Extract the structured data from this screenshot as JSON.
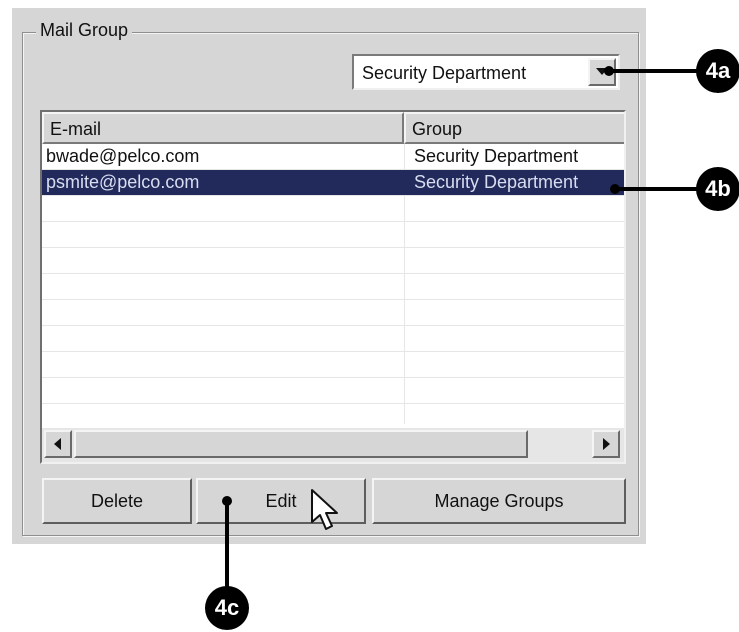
{
  "mail_group": {
    "title": "Mail Group",
    "group_select": {
      "selected": "Security Department"
    },
    "table": {
      "headers": {
        "email": "E-mail",
        "group": "Group"
      },
      "rows": [
        {
          "email": "bwade@pelco.com",
          "group": "Security Department",
          "selected": false
        },
        {
          "email": "psmite@pelco.com",
          "group": "Security Department",
          "selected": true
        }
      ]
    },
    "buttons": {
      "delete": "Delete",
      "edit": "Edit",
      "manage_groups": "Manage Groups"
    }
  },
  "callouts": {
    "a": "4a",
    "b": "4b",
    "c": "4c"
  },
  "icons": [
    "dropdown-arrow-icon",
    "scroll-left-icon",
    "scroll-right-icon",
    "mouse-pointer-icon"
  ],
  "colors": {
    "selection": "#222a5c",
    "dialog_bg": "#d6d6d6"
  }
}
